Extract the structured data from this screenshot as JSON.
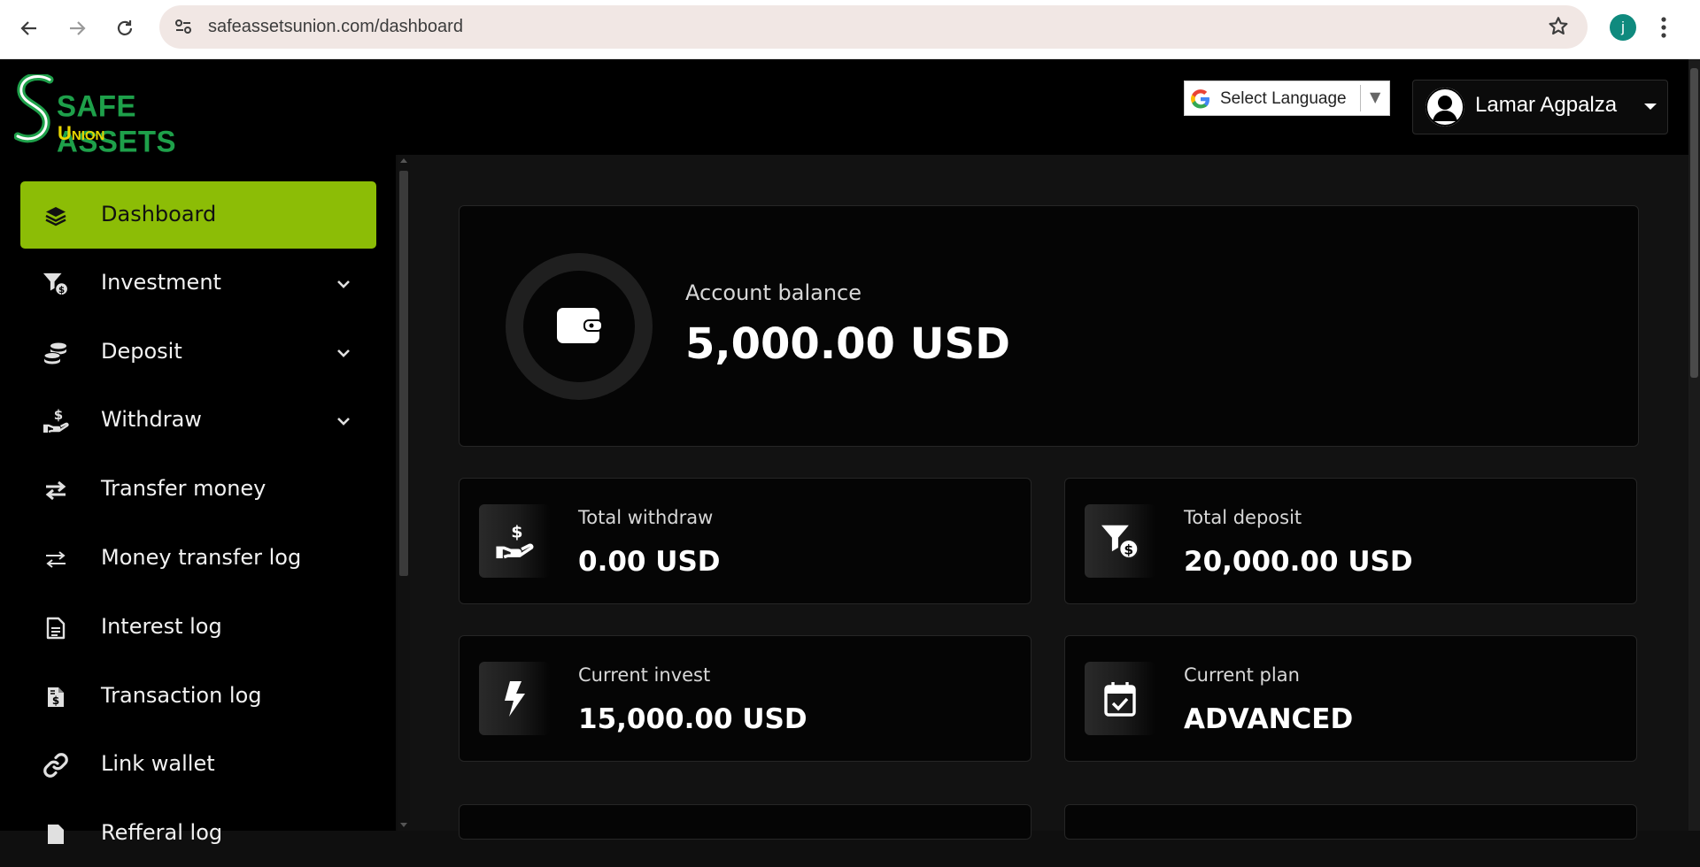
{
  "browser": {
    "url": "safeassetsunion.com/dashboard",
    "profile_initial": "j"
  },
  "header": {
    "logo_line1": "SAFE ASSETS",
    "logo_line2": "Union",
    "language_label": "Select Language",
    "user_name": "Lamar Agpalza"
  },
  "sidebar": {
    "items": [
      {
        "label": "Dashboard",
        "icon": "layers-icon",
        "active": true
      },
      {
        "label": "Investment",
        "icon": "funnel-dollar-icon",
        "dropdown": true
      },
      {
        "label": "Deposit",
        "icon": "coins-icon",
        "dropdown": true
      },
      {
        "label": "Withdraw",
        "icon": "hand-dollar-icon",
        "dropdown": true
      },
      {
        "label": "Transfer money",
        "icon": "exchange-icon"
      },
      {
        "label": "Money transfer log",
        "icon": "exchange-thin-icon"
      },
      {
        "label": "Interest log",
        "icon": "document-icon"
      },
      {
        "label": "Transaction log",
        "icon": "invoice-dollar-icon"
      },
      {
        "label": "Link wallet",
        "icon": "link-icon"
      },
      {
        "label": "Refferal log",
        "icon": "document-icon"
      }
    ]
  },
  "dashboard": {
    "balance_label": "Account balance",
    "balance_value": "5,000.00 USD",
    "stats": [
      {
        "label": "Total withdraw",
        "value": "0.00 USD",
        "icon": "hand-dollar-icon"
      },
      {
        "label": "Total deposit",
        "value": "20,000.00 USD",
        "icon": "funnel-dollar-icon"
      },
      {
        "label": "Current invest",
        "value": "15,000.00 USD",
        "icon": "bolt-icon"
      },
      {
        "label": "Current plan",
        "value": "ADVANCED",
        "icon": "calendar-check-icon"
      }
    ]
  },
  "colors": {
    "accent": "#8cbd06",
    "logo_green": "#1ea04a",
    "logo_yellow": "#e8d600",
    "background": "#121212"
  }
}
